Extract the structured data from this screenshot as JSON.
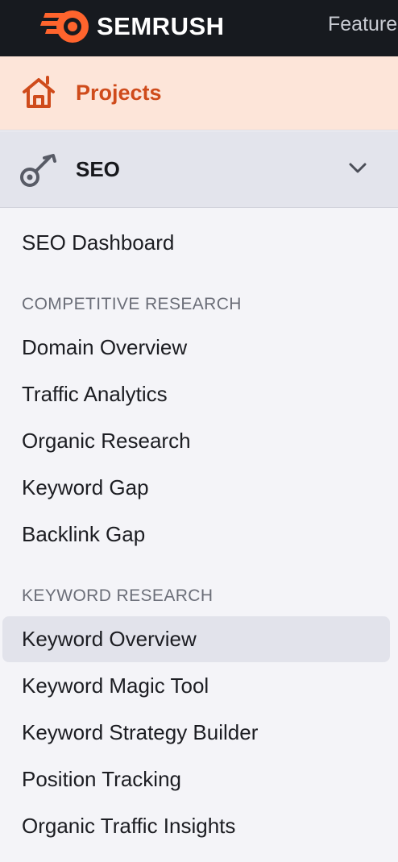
{
  "header": {
    "brand": "SEMRUSH",
    "top_link": "Features"
  },
  "sidebar": {
    "projects_label": "Projects",
    "seo_label": "SEO",
    "dashboard_label": "SEO Dashboard",
    "competitive_section": "COMPETITIVE RESEARCH",
    "competitive_items": [
      "Domain Overview",
      "Traffic Analytics",
      "Organic Research",
      "Keyword Gap",
      "Backlink Gap"
    ],
    "keyword_section": "KEYWORD RESEARCH",
    "keyword_items": [
      "Keyword Overview",
      "Keyword Magic Tool",
      "Keyword Strategy Builder",
      "Position Tracking",
      "Organic Traffic Insights"
    ],
    "active_item": "Keyword Overview"
  },
  "colors": {
    "brand_orange": "#ff642d",
    "projects_text": "#cf4b1b",
    "topbar_bg": "#171a1f"
  }
}
